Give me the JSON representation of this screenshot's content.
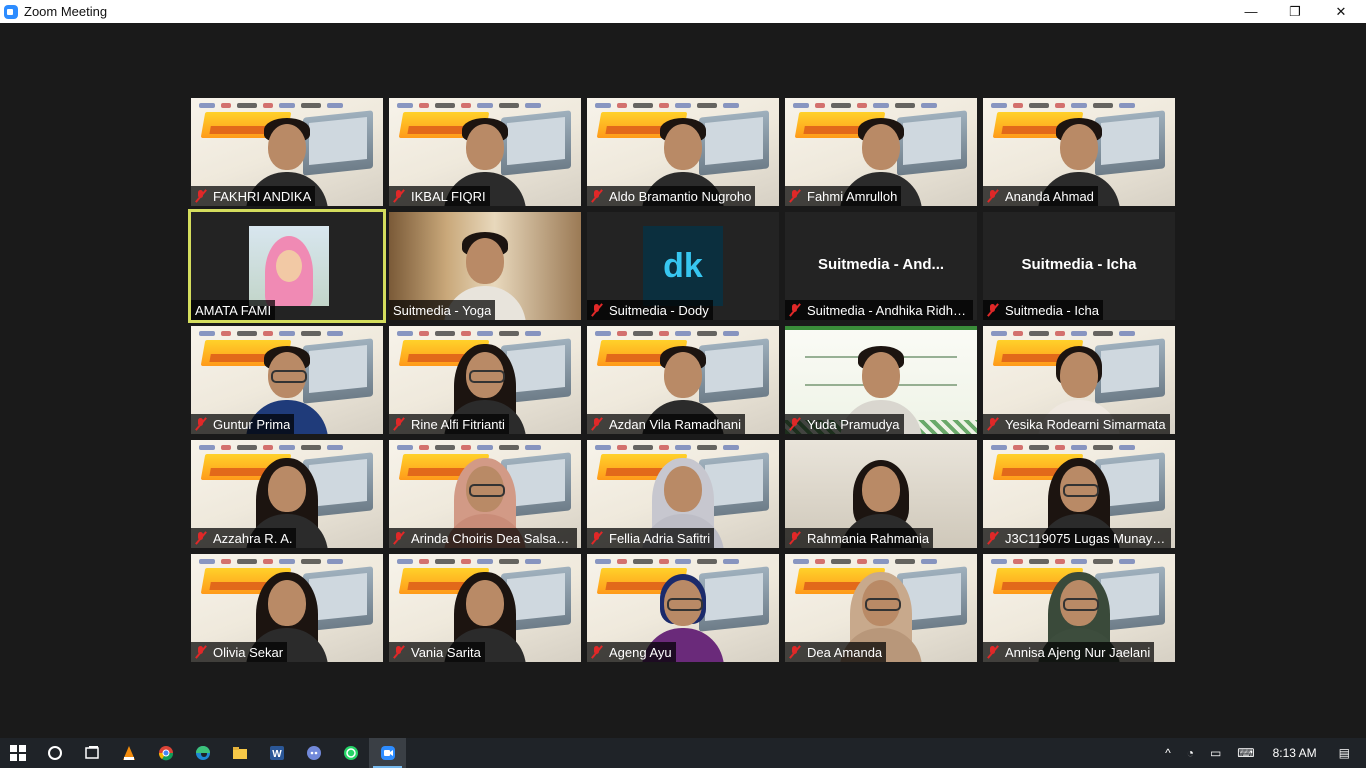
{
  "window": {
    "title": "Zoom Meeting",
    "minimize": "—",
    "restore": "❐",
    "close": "✕"
  },
  "participants": [
    {
      "name": "FAKHRI ANDIKA",
      "muted": true
    },
    {
      "name": "IKBAL FIQRI",
      "muted": true
    },
    {
      "name": "Aldo Bramantio Nugroho",
      "muted": true
    },
    {
      "name": "Fahmi Amrulloh",
      "muted": true
    },
    {
      "name": "Ananda Ahmad",
      "muted": true
    },
    {
      "name": "AMATA FAMI",
      "muted": false,
      "active_speaker": true
    },
    {
      "name": "Suitmedia - Yoga",
      "muted": false
    },
    {
      "name": "Suitmedia - Dody",
      "muted": true,
      "avatar_text": "dk"
    },
    {
      "name": "Suitmedia - Andhika Ridho...",
      "muted": true,
      "center_text": "Suitmedia - And..."
    },
    {
      "name": "Suitmedia - Icha",
      "muted": true,
      "center_text": "Suitmedia - Icha"
    },
    {
      "name": "Guntur Prima",
      "muted": true
    },
    {
      "name": "Rine Alfi Fitrianti",
      "muted": true
    },
    {
      "name": "Azdan Vila Ramadhani",
      "muted": true
    },
    {
      "name": "Yuda Pramudya",
      "muted": true
    },
    {
      "name": "Yesika Rodearni Simarmata",
      "muted": true
    },
    {
      "name": "Azzahra R. A.",
      "muted": true
    },
    {
      "name": "Arinda Choiris Dea Salsabe...",
      "muted": true
    },
    {
      "name": "Fellia Adria Safitri",
      "muted": true
    },
    {
      "name": "Rahmania Rahmania",
      "muted": true
    },
    {
      "name": "J3C119075 Lugas Munayas...",
      "muted": true
    },
    {
      "name": "Olivia Sekar",
      "muted": true
    },
    {
      "name": "Vania Sarita",
      "muted": true
    },
    {
      "name": "Ageng Ayu",
      "muted": true
    },
    {
      "name": "Dea Amanda",
      "muted": true
    },
    {
      "name": "Annisa Ajeng Nur Jaelani",
      "muted": true
    }
  ],
  "taskbar": {
    "apps": [
      "start-icon",
      "cortana-icon",
      "task-view-icon",
      "vlc-icon",
      "chrome-icon",
      "edge-icon",
      "file-explorer-icon",
      "word-icon",
      "discord-icon",
      "whatsapp-icon",
      "zoom-icon"
    ],
    "clock": "8:13 AM"
  },
  "colors": {
    "active_speaker_border": "#d4dd5d",
    "muted_icon": "#e02828",
    "taskbar": "#1f2328"
  }
}
